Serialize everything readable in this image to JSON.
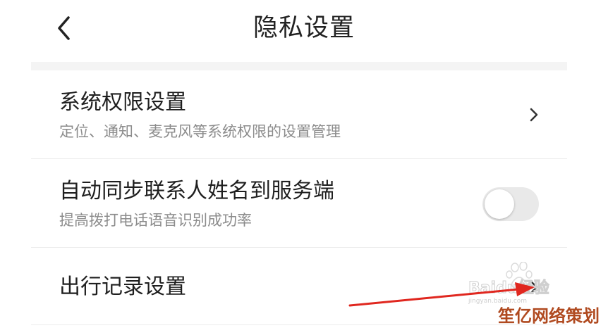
{
  "header": {
    "title": "隐私设置"
  },
  "settings": [
    {
      "title": "系统权限设置",
      "subtitle": "定位、通知、麦克风等系统权限的设置管理",
      "control": "chevron"
    },
    {
      "title": "自动同步联系人姓名到服务端",
      "subtitle": "提高拨打电话语音识别成功率",
      "control": "toggle",
      "enabled": false
    },
    {
      "title": "出行记录设置",
      "control": "chevron"
    }
  ],
  "overlay": {
    "watermark_text": "Baidu经验",
    "watermark_url": "jingyan.baidu.com",
    "corner_text": "笙亿网络策划",
    "arrow_color": "#e0271f"
  },
  "colors": {
    "title_text": "#222222",
    "subtitle_text": "#8c8c8c",
    "toggle_off": "#e9e9e9",
    "divider": "#ececec"
  }
}
